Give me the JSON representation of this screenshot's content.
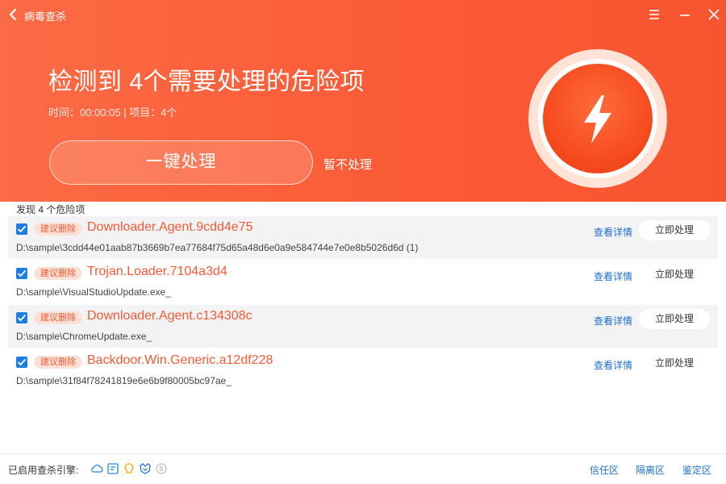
{
  "titlebar": {
    "title": "病毒查杀"
  },
  "summary": {
    "headline": "检测到 4个需要处理的危险项",
    "meta": "时间：00:00:05 | 项目：4个"
  },
  "actions": {
    "one_key": "一键处理",
    "skip": "暂不处理"
  },
  "list": {
    "caption": "发现 4 个危险项",
    "items": [
      {
        "tag": "建议删除",
        "name": "Downloader.Agent.9cdd4e75",
        "path": "D:\\sample\\3cdd44e01aab87b3669b7ea77684f75d65a48d6e0a9e584744e7e0e8b5026d6d (1)",
        "details": "查看详情",
        "handle": "立即处理",
        "checked": true
      },
      {
        "tag": "建议删除",
        "name": "Trojan.Loader.7104a3d4",
        "path": "D:\\sample\\VisualStudioUpdate.exe_",
        "details": "查看详情",
        "handle": "立即处理",
        "checked": true
      },
      {
        "tag": "建议删除",
        "name": "Downloader.Agent.c134308c",
        "path": "D:\\sample\\ChromeUpdate.exe_",
        "details": "查看详情",
        "handle": "立即处理",
        "checked": true
      },
      {
        "tag": "建议删除",
        "name": "Backdoor.Win.Generic.a12df228",
        "path": "D:\\sample\\31f84f78241819e6e6b9f80005bc97ae_",
        "details": "查看详情",
        "handle": "立即处理",
        "checked": true
      }
    ]
  },
  "footer": {
    "engine_label": "已启用查杀引擎:",
    "engines": [
      "cloud-engine-icon",
      "qvm-engine-icon",
      "qex-engine-icon",
      "kunpeng-engine-icon",
      "bitdefender-engine-icon"
    ],
    "trust": "信任区",
    "quarantine": "隔离区",
    "identify": "鉴定区"
  },
  "colors": {
    "header": "#fb5a36",
    "threat": "#f25a36",
    "link": "#1f6fc7",
    "checkbox": "#1f7de0"
  }
}
